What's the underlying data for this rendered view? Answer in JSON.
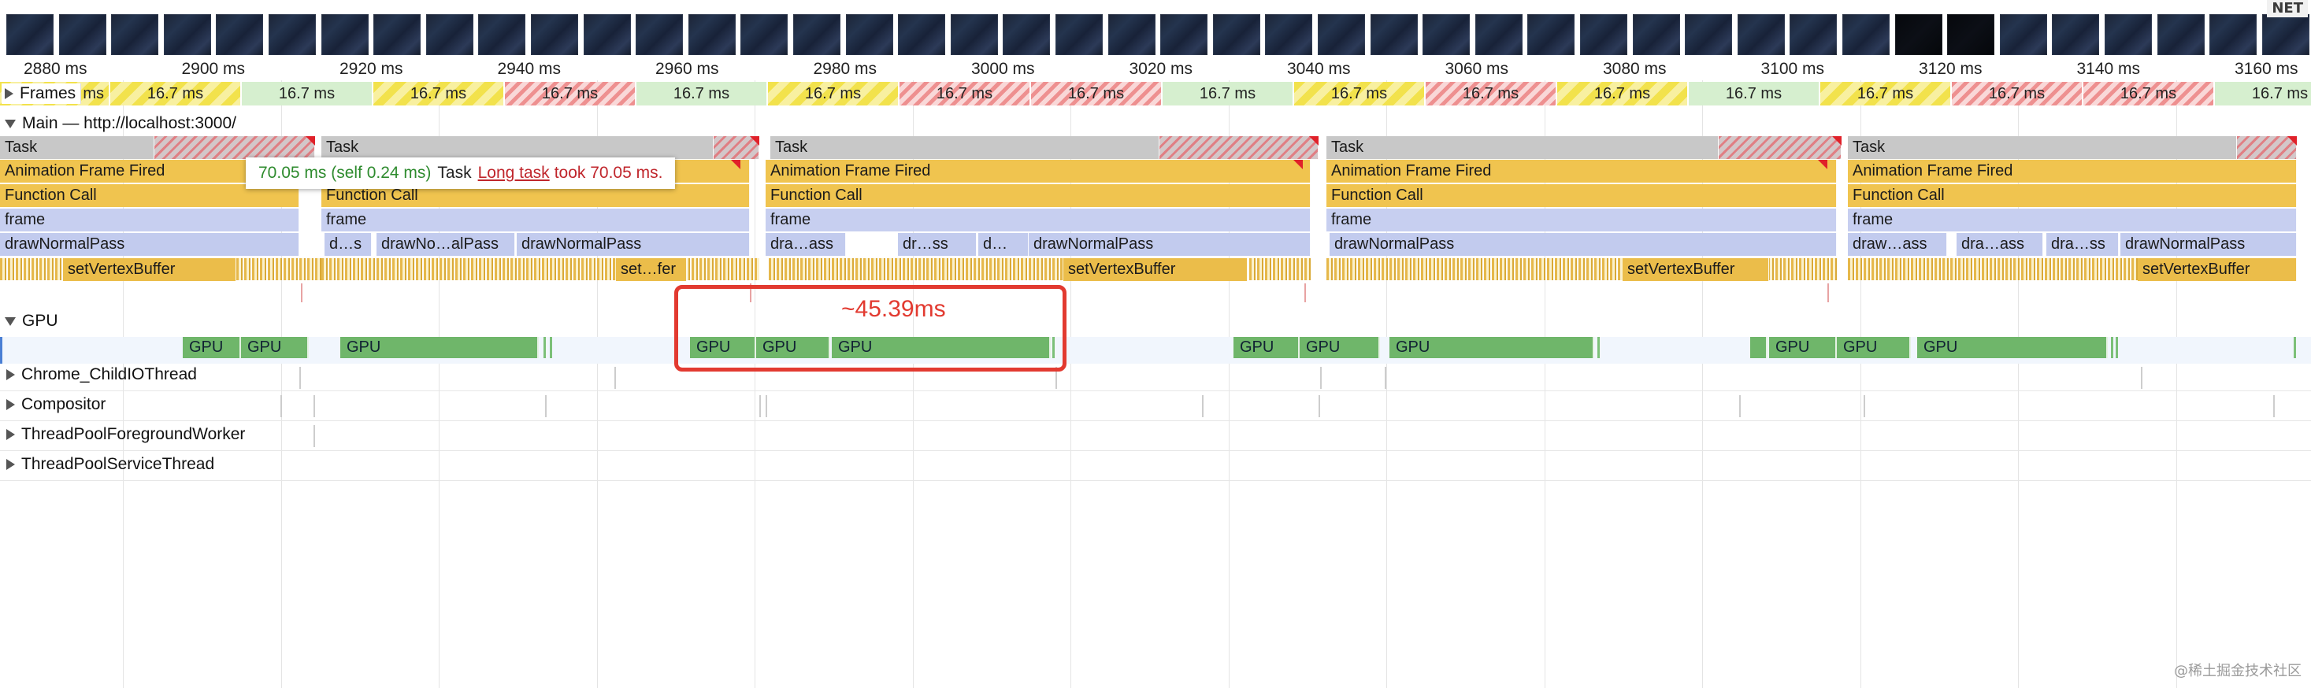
{
  "net_badge": "NET",
  "ruler": {
    "ticks": [
      "2880 ms",
      "2900 ms",
      "2920 ms",
      "2940 ms",
      "2960 ms",
      "2980 ms",
      "3000 ms",
      "3020 ms",
      "3040 ms",
      "3060 ms",
      "3080 ms",
      "3100 ms",
      "3120 ms",
      "3140 ms",
      "3160 ms"
    ]
  },
  "frames": {
    "label": "Frames",
    "first_partial": "ms",
    "items": [
      "16.7 ms",
      "16.7 ms",
      "16.7 ms",
      "16.7 ms",
      "16.7 ms",
      "16.7 ms",
      "16.7 ms",
      "16.7 ms",
      "16.7 ms",
      "16.7 ms",
      "16.7 ms",
      "16.7 ms",
      "16.7 ms",
      "16.7 ms",
      "16.7 ms",
      "16.7 ms",
      "16.7 ms"
    ],
    "status": [
      "yellow",
      "green",
      "yellow",
      "red",
      "green",
      "yellow",
      "red",
      "red",
      "green",
      "yellow",
      "red",
      "yellow",
      "green",
      "yellow",
      "red",
      "red",
      "green"
    ]
  },
  "main": {
    "label": "Main — http://localhost:3000/",
    "task_label": "Task",
    "animation_label": "Animation Frame Fired",
    "function_label": "Function Call",
    "frame_label": "frame",
    "draw_label": "drawNormalPass",
    "draw_short": [
      "d…s",
      "drawNo…alPass",
      "dra…ass",
      "dr…ss",
      "d…",
      "draw…ass",
      "dra…ass",
      "dra…ss"
    ],
    "vertex_label": "setVertexBuffer",
    "vertex_short": "set…fer"
  },
  "tooltip": {
    "time": "70.05 ms (self 0.24 ms)",
    "task": "Task",
    "link": "Long task",
    "took": "took 70.05 ms."
  },
  "gpu": {
    "label": "GPU",
    "block_label": "GPU"
  },
  "threads": [
    "Chrome_ChildIOThread",
    "Compositor",
    "ThreadPoolForegroundWorker",
    "ThreadPoolServiceThread"
  ],
  "annotation": "~45.39ms",
  "watermark": "@稀土掘金技术社区",
  "colors": {
    "frame_green": "#d6efcf",
    "frame_yellow": "#f2e24c",
    "frame_red": "#ee9090",
    "task": "#c8c8c8",
    "animation": "#f0c44f",
    "draw": "#c2cbee",
    "gpu": "#6fb66a",
    "annotation": "#e23a30"
  }
}
